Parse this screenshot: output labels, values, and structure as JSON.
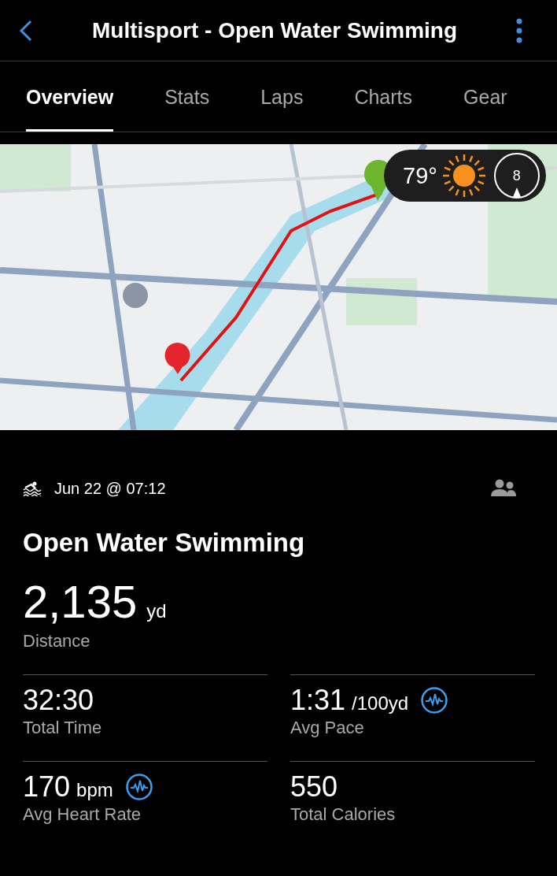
{
  "header": {
    "title": "Multisport - Open Water Swimming"
  },
  "tabs": [
    {
      "label": "Overview",
      "selected": true
    },
    {
      "label": "Stats",
      "selected": false
    },
    {
      "label": "Laps",
      "selected": false
    },
    {
      "label": "Charts",
      "selected": false
    },
    {
      "label": "Gear",
      "selected": false
    }
  ],
  "map": {
    "kind": "picture",
    "weather": {
      "temperature": "79°",
      "wind_speed": "8"
    }
  },
  "activity": {
    "date": "Jun 22 @ 07:12",
    "title": "Open Water Swimming"
  },
  "distance": {
    "value": "2,135",
    "unit": "yd",
    "label": "Distance"
  },
  "stats": [
    {
      "value": "32:30",
      "label": "Total Time",
      "chart_link": false
    },
    {
      "value": "1:31",
      "unit": "/100yd",
      "label": "Avg Pace",
      "chart_link": true
    },
    {
      "value": "170",
      "unit": "bpm",
      "label": "Avg Heart Rate",
      "chart_link": true
    },
    {
      "value": "550",
      "label": "Total Calories",
      "chart_link": false
    }
  ]
}
